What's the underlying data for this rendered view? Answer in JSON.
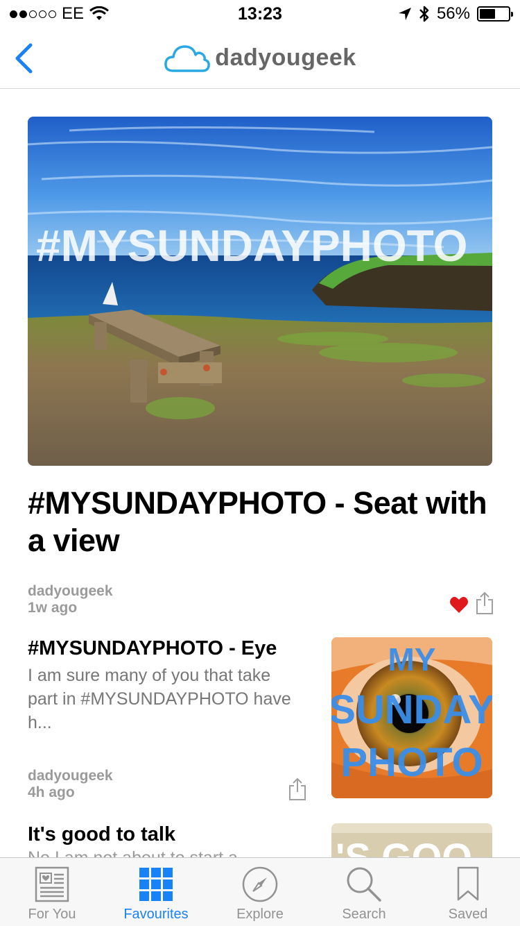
{
  "status_bar": {
    "carrier": "EE",
    "time": "13:23",
    "battery_percent": "56%",
    "battery_level": 0.56,
    "signal_bars_filled": 2,
    "signal_bars_total": 5
  },
  "nav": {
    "logo_text": "dadyougeek",
    "back_icon": "chevron-left-icon",
    "accent_color": "#1a82f7"
  },
  "hero_article": {
    "image_overlay_text": "#MYSUNDAYPHOTO",
    "title": "#MYSUNDAYPHOTO - Seat with a view",
    "source": "dadyougeek",
    "time_ago": "1w ago",
    "liked": true
  },
  "articles": [
    {
      "title": "#MYSUNDAYPHOTO - Eye",
      "excerpt": "I am sure many of you that take part in #MYSUNDAYPHOTO have h...",
      "source": "dadyougeek",
      "time_ago": "4h ago",
      "thumb_text": [
        "MY",
        "SUNDAY",
        "PHOTO"
      ]
    },
    {
      "title": "It's good to talk",
      "excerpt": "No I am not about to start a",
      "thumb_text": "'S GOO"
    }
  ],
  "tab_bar": {
    "tabs": [
      {
        "label": "For You",
        "icon": "news-icon"
      },
      {
        "label": "Favourites",
        "icon": "grid-icon"
      },
      {
        "label": "Explore",
        "icon": "compass-icon"
      },
      {
        "label": "Search",
        "icon": "search-icon"
      },
      {
        "label": "Saved",
        "icon": "bookmark-icon"
      }
    ],
    "active": "Favourites"
  }
}
